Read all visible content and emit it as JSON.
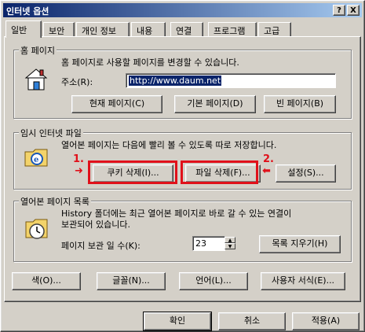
{
  "window": {
    "title": "인터넷 옵션",
    "help_button": "?",
    "close_button": "X"
  },
  "tabs": [
    {
      "label": "일반",
      "active": true
    },
    {
      "label": "보안",
      "active": false
    },
    {
      "label": "개인 정보",
      "active": false
    },
    {
      "label": "내용",
      "active": false
    },
    {
      "label": "연결",
      "active": false
    },
    {
      "label": "프로그램",
      "active": false
    },
    {
      "label": "고급",
      "active": false
    }
  ],
  "home_page": {
    "title": "홈 페이지",
    "description": "홈 페이지로 사용할 페이지를 변경할 수 있습니다.",
    "address_label": "주소(R):",
    "address_value": "http://www.daum.net",
    "buttons": {
      "current": "현재 페이지(C)",
      "default": "기본 페이지(D)",
      "blank": "빈 페이지(B)"
    }
  },
  "temp_files": {
    "title": "임시 인터넷 파일",
    "description": "열어본 페이지는 다음에 빨리 볼 수 있도록 따로 저장합니다.",
    "buttons": {
      "delete_cookies": "쿠키 삭제(I)...",
      "delete_files": "파일 삭제(F)...",
      "settings": "설정(S)..."
    }
  },
  "history": {
    "title": "열어본 페이지 목록",
    "description_line1": "History 폴더에는 최근 열어본 페이지로 바로 갈 수 있는 연결이",
    "description_line2": "보관되어 있습니다.",
    "days_label": "페이지 보관 일 수(K):",
    "days_value": "23",
    "clear_button": "목록 지우기(H)"
  },
  "bottom_buttons": {
    "colors": "색(O)...",
    "fonts": "글꼴(N)...",
    "languages": "언어(L)...",
    "accessibility": "사용자 서식(E)..."
  },
  "dialog_buttons": {
    "ok": "확인",
    "cancel": "취소",
    "apply": "적용(A)"
  },
  "annotations": {
    "step1": "1.",
    "step2": "2."
  },
  "colors": {
    "annotation_red": "#e0101a",
    "titlebar": "#0a246a",
    "face": "#d4d0c8"
  }
}
